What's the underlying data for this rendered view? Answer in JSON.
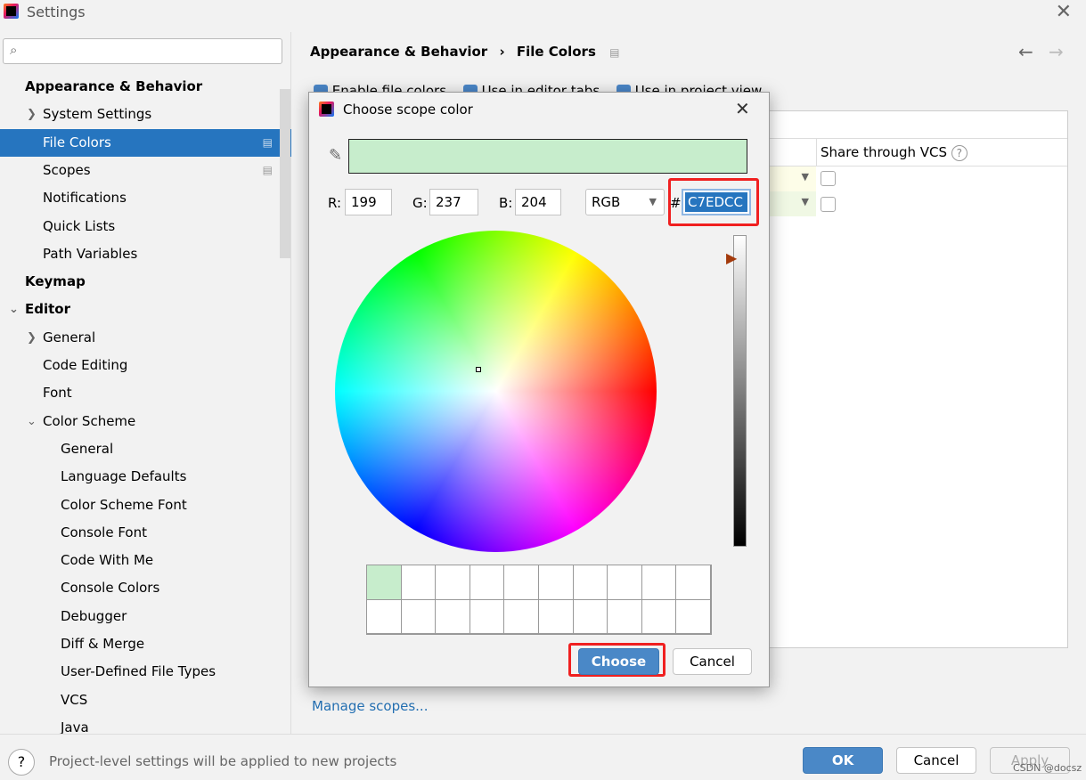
{
  "window": {
    "title": "Settings",
    "close": "✕"
  },
  "search": {
    "icon": "search-icon",
    "glyph": "🔍︎"
  },
  "sidebar": {
    "items": [
      {
        "label": "Appearance & Behavior",
        "level": 0,
        "bold": true
      },
      {
        "label": "System Settings",
        "level": 1,
        "chevron": "right"
      },
      {
        "label": "File Colors",
        "level": 1,
        "selected": true,
        "project": true
      },
      {
        "label": "Scopes",
        "level": 1,
        "project": true
      },
      {
        "label": "Notifications",
        "level": 1
      },
      {
        "label": "Quick Lists",
        "level": 1
      },
      {
        "label": "Path Variables",
        "level": 1
      },
      {
        "label": "Keymap",
        "level": 0,
        "bold": true
      },
      {
        "label": "Editor",
        "level": 0,
        "bold": true,
        "chevron": "down"
      },
      {
        "label": "General",
        "level": 1,
        "chevron": "right"
      },
      {
        "label": "Code Editing",
        "level": 1
      },
      {
        "label": "Font",
        "level": 1
      },
      {
        "label": "Color Scheme",
        "level": 1,
        "chevron": "down"
      },
      {
        "label": "General",
        "level": 2
      },
      {
        "label": "Language Defaults",
        "level": 2
      },
      {
        "label": "Color Scheme Font",
        "level": 2
      },
      {
        "label": "Console Font",
        "level": 2
      },
      {
        "label": "Code With Me",
        "level": 2
      },
      {
        "label": "Console Colors",
        "level": 2
      },
      {
        "label": "Debugger",
        "level": 2
      },
      {
        "label": "Diff & Merge",
        "level": 2
      },
      {
        "label": "User-Defined File Types",
        "level": 2
      },
      {
        "label": "VCS",
        "level": 2
      },
      {
        "label": "Java",
        "level": 2
      }
    ]
  },
  "header": {
    "breadcrumb": [
      "Appearance & Behavior",
      "File Colors"
    ],
    "sep": "›",
    "back": "←",
    "forward": "→"
  },
  "options": [
    {
      "label": "Enable file colors",
      "checked": true
    },
    {
      "label": "Use in editor tabs",
      "checked": true
    },
    {
      "label": "Use in project view",
      "checked": true
    }
  ],
  "table": {
    "share_header": "Share through VCS",
    "help": "?",
    "rows": [
      {
        "color": "#fdfde8",
        "shared": false
      },
      {
        "color": "#f0f8e4",
        "shared": false
      }
    ]
  },
  "manage_scopes": "Manage scopes...",
  "dialog": {
    "title": "Choose scope color",
    "close": "✕",
    "preview_color": "#C7EDCC",
    "r_label": "R:",
    "r": "199",
    "g_label": "G:",
    "g": "237",
    "b_label": "B:",
    "b": "204",
    "mode": "RGB",
    "hash": "#",
    "hex": "C7EDCC",
    "recent_colors": [
      "#C7EDCC"
    ],
    "choose": "Choose",
    "cancel": "Cancel"
  },
  "footer": {
    "help": "?",
    "note": "Project-level settings will be applied to new projects",
    "ok": "OK",
    "cancel": "Cancel",
    "apply": "Apply"
  },
  "watermark": "CSDN @docsz",
  "colors": {
    "accent": "#2675bf",
    "highlight": "#f02020"
  }
}
